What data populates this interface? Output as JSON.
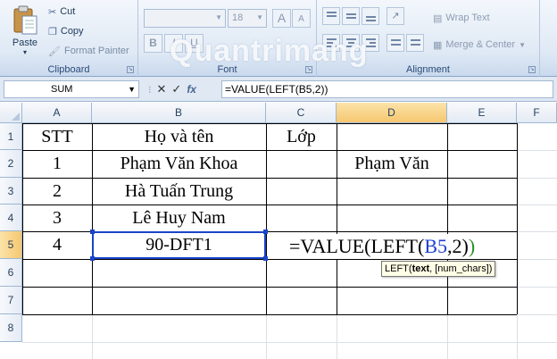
{
  "ribbon": {
    "clipboard": {
      "paste_label": "Paste",
      "cut_label": "Cut",
      "copy_label": "Copy",
      "format_painter_label": "Format Painter",
      "group_label": "Clipboard"
    },
    "font": {
      "font_name_value": "",
      "font_size_value": "18",
      "grow_label": "A",
      "shrink_label": "A",
      "bold_label": "B",
      "italic_label": "I",
      "underline_label": "U",
      "group_label": "Font"
    },
    "alignment": {
      "wrap_text_label": "Wrap Text",
      "merge_center_label": "Merge & Center",
      "group_label": "Alignment"
    }
  },
  "watermark": "Quantrimang",
  "formula_bar": {
    "name_box": "SUM",
    "fx_label": "fx",
    "formula": "=VALUE(LEFT(B5,2))"
  },
  "columns": [
    "A",
    "B",
    "C",
    "D",
    "E",
    "F"
  ],
  "rows": [
    "1",
    "2",
    "3",
    "4",
    "5",
    "6",
    "7",
    "8"
  ],
  "cells": {
    "A1": "STT",
    "B1": "Họ và tên",
    "C1": "Lớp",
    "A2": "1",
    "B2": "Phạm Văn Khoa",
    "D2": "Phạm Văn",
    "A3": "2",
    "B3": "Hà Tuấn Trung",
    "A4": "3",
    "B4": "Lê Huy Nam",
    "A5": "4",
    "B5": "90-DFT1"
  },
  "editing_cell": {
    "prefix": "=VALUE(LEFT(",
    "ref": "B5",
    "args": ",2)",
    "close": ")"
  },
  "tooltip": {
    "fn": "LEFT(",
    "arg1": "text",
    "rest": ", [num_chars])"
  },
  "colors": {
    "selection": "#1a44c8",
    "ref_blue": "#1f3fd0",
    "paren_green": "#2e8b2e",
    "active_header": "#f6c770"
  }
}
